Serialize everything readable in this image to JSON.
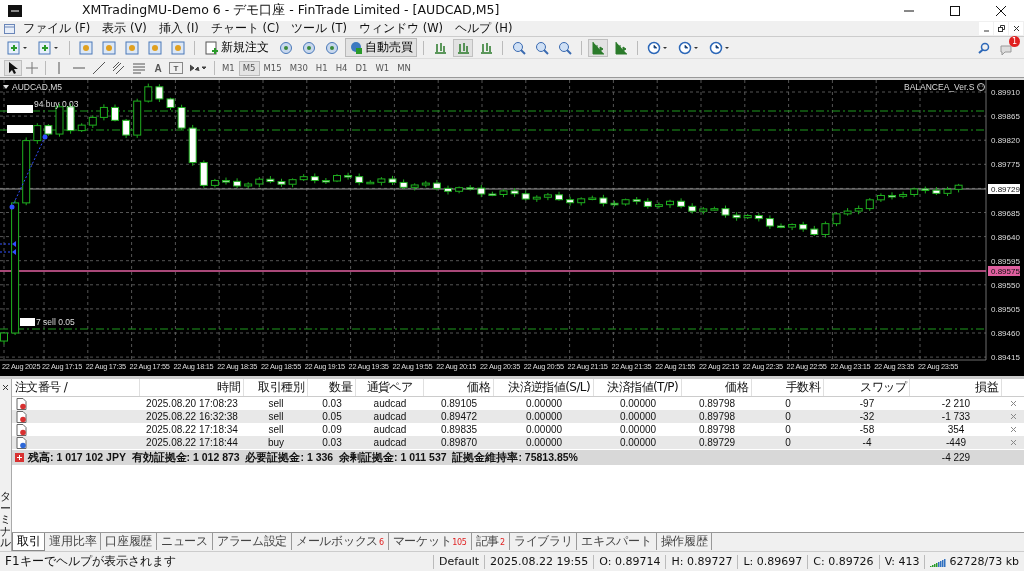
{
  "window": {
    "title": "XMTradingMU-Demo 6 - デモ口座 - FinTrade Limited - [AUDCAD,M5]"
  },
  "menu": [
    "ファイル (F)",
    "表示 (V)",
    "挿入 (I)",
    "チャート (C)",
    "ツール (T)",
    "ウィンドウ (W)",
    "ヘルプ (H)"
  ],
  "toolbar": {
    "new_order": "新規注文",
    "auto_trading": {
      "label": "自動売買",
      "on": true
    },
    "text_tool": "A",
    "label_tool": "T",
    "timeframes": [
      {
        "label": "M1",
        "selected": false
      },
      {
        "label": "M5",
        "selected": true
      },
      {
        "label": "M15",
        "selected": false
      },
      {
        "label": "M30",
        "selected": false
      },
      {
        "label": "H1",
        "selected": false
      },
      {
        "label": "H4",
        "selected": false
      },
      {
        "label": "D1",
        "selected": false
      },
      {
        "label": "W1",
        "selected": false
      },
      {
        "label": "MN",
        "selected": false
      }
    ]
  },
  "notifications": {
    "count": "1"
  },
  "chart": {
    "symbol": "AUDCAD,M5",
    "expert": "BALANCEA_Ver.S",
    "price_labels": [
      "0.89910",
      "0.89865",
      "0.89820",
      "0.89775",
      "0.89685",
      "0.89640",
      "0.89595",
      "0.89550",
      "0.89505",
      "0.89460",
      "0.89415"
    ],
    "bid_label": "0.89729",
    "alert_label": "0.89575",
    "time_labels": [
      "22 Aug 2025",
      "22 Aug 17:15",
      "22 Aug 17:35",
      "22 Aug 17:55",
      "22 Aug 18:15",
      "22 Aug 18:35",
      "22 Aug 18:55",
      "22 Aug 19:15",
      "22 Aug 19:35",
      "22 Aug 19:55",
      "22 Aug 20:15",
      "22 Aug 20:35",
      "22 Aug 20:55",
      "22 Aug 21:15",
      "22 Aug 21:35",
      "22 Aug 21:55",
      "22 Aug 22:15",
      "22 Aug 22:35",
      "22 Aug 22:55",
      "22 Aug 23:15",
      "22 Aug 23:35",
      "22 Aug 23:55"
    ],
    "trade_labels": [
      "94 buy 0.03",
      "7 sell 0.05"
    ]
  },
  "terminal": {
    "side_label": "ターミナル",
    "columns": [
      "注文番号 /",
      "時間",
      "取引種別",
      "数量",
      "通貨ペア",
      "価格",
      "決済逆指値(S/L)",
      "決済指値(T/P)",
      "価格",
      "手数料",
      "スワップ",
      "損益"
    ],
    "rows": [
      {
        "kind": "sell",
        "cells": [
          "",
          "2025.08.20 17:08:23",
          "sell",
          "0.03",
          "audcad",
          "0.89105",
          "0.00000",
          "0.00000",
          "0.89798",
          "0",
          "-97",
          "-2 210"
        ]
      },
      {
        "kind": "sell",
        "cells": [
          "",
          "2025.08.22 16:32:38",
          "sell",
          "0.05",
          "audcad",
          "0.89472",
          "0.00000",
          "0.00000",
          "0.89798",
          "0",
          "-32",
          "-1 733"
        ]
      },
      {
        "kind": "sell",
        "cells": [
          "",
          "2025.08.22 17:18:34",
          "sell",
          "0.09",
          "audcad",
          "0.89835",
          "0.00000",
          "0.00000",
          "0.89798",
          "0",
          "-58",
          "354"
        ]
      },
      {
        "kind": "buy",
        "cells": [
          "",
          "2025.08.22 17:18:44",
          "buy",
          "0.03",
          "audcad",
          "0.89870",
          "0.00000",
          "0.00000",
          "0.89729",
          "0",
          "-4",
          "-449"
        ]
      }
    ],
    "summary": {
      "text": "残高: 1 017 102 JPY  有効証拠金: 1 012 873  必要証拠金: 1 336  余剰証拠金: 1 011 537  証拠金維持率: 75813.85%",
      "profit": "-4 229"
    },
    "tabs": [
      {
        "label": "取引",
        "selected": true
      },
      {
        "label": "運用比率",
        "selected": false
      },
      {
        "label": "口座履歴",
        "selected": false
      },
      {
        "label": "ニュース",
        "selected": false
      },
      {
        "label": "アラーム設定",
        "selected": false
      },
      {
        "label": "メールボックス",
        "badge": "6",
        "selected": false
      },
      {
        "label": "マーケット",
        "badge": "105",
        "selected": false
      },
      {
        "label": "記事",
        "badge": "2",
        "selected": false
      },
      {
        "label": "ライブラリ",
        "selected": false
      },
      {
        "label": "エキスパート",
        "selected": false
      },
      {
        "label": "操作履歴",
        "selected": false
      }
    ]
  },
  "status_bar": [
    "F1キーでヘルプが表示されます",
    "Default",
    "2025.08.22 19:55",
    "O: 0.89714",
    "H: 0.89727",
    "L: 0.89697",
    "C: 0.89726",
    "V: 413",
    "62728/73 kb"
  ]
}
